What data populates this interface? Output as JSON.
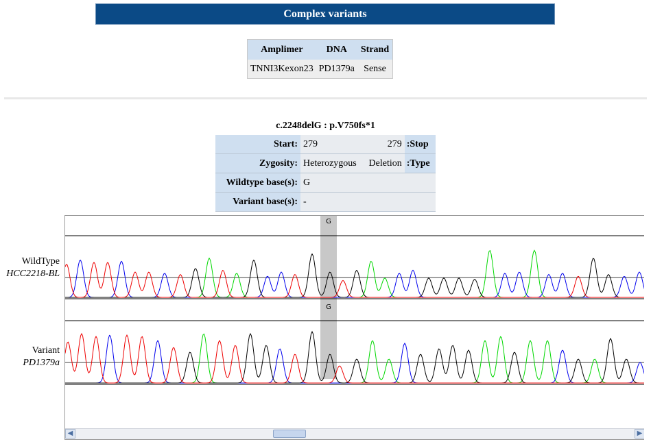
{
  "page_title": "Complex variants",
  "amplimer_table": {
    "headers": [
      "Amplimer",
      "DNA",
      "Strand"
    ],
    "row": [
      "TNNI3Kexon23",
      "PD1379a",
      "Sense"
    ]
  },
  "variant": {
    "title": "c.2248delG : p.V750fs*1",
    "start_label": "Start:",
    "start_value": "279",
    "stop_value": "279",
    "stop_label": ":Stop",
    "zygosity_label": "Zygosity:",
    "zygosity_value": "Heterozygous",
    "type_value": "Deletion",
    "type_label": ":Type",
    "wildtype_label": "Wildtype base(s):",
    "wildtype_value": "G",
    "variant_label": "Variant base(s):",
    "variant_value": "-"
  },
  "traces": {
    "wildtype": {
      "label": "WildType",
      "sample": "HCC2218-BL",
      "marker": "G"
    },
    "variant": {
      "label": "Variant",
      "sample": "PD1379a",
      "marker": "G"
    }
  },
  "colors": {
    "header_bg": "#0b4a86",
    "label_bg": "#cfdff0",
    "trace_A": "#00d800",
    "trace_C": "#0000ee",
    "trace_G": "#000000",
    "trace_T": "#ee0000",
    "highlight": "#c8c8c8"
  },
  "scrollbar": {
    "left_icon": "chevron-left-icon",
    "right_icon": "chevron-right-icon"
  }
}
